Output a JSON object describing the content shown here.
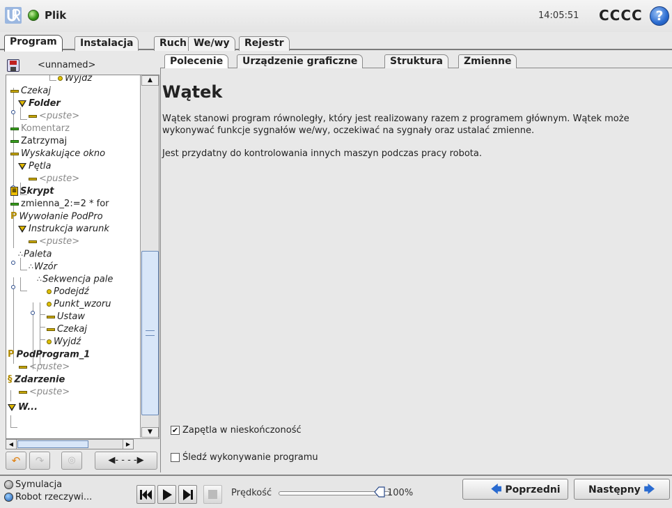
{
  "topbar": {
    "file_label": "Plik",
    "clock": "14:05:51",
    "robot_name": "CCCC",
    "help_label": "?"
  },
  "main_tabs": [
    "Program",
    "Instalacja",
    "Ruch",
    "We/wy",
    "Rejestr"
  ],
  "program": {
    "name": "<unnamed>"
  },
  "tree": [
    {
      "label": "Wyjdź",
      "icon": "waypoint-icon"
    },
    {
      "label": "Czekaj",
      "icon": "wait-icon"
    },
    {
      "label": "Folder",
      "icon": "folder-icon"
    },
    {
      "label": "<puste>",
      "icon": "wait-icon"
    },
    {
      "label": "Komentarz",
      "icon": "comment-icon"
    },
    {
      "label": "Zatrzymaj",
      "icon": "halt-icon"
    },
    {
      "label": "Wyskakujące okno",
      "icon": "popup-icon"
    },
    {
      "label": "Pętla",
      "icon": "loop-icon"
    },
    {
      "label": "<puste>",
      "icon": "wait-icon"
    },
    {
      "label": "Skrypt",
      "icon": "script-icon"
    },
    {
      "label": "zmienna_2:=2 * for",
      "icon": "assignment-icon"
    },
    {
      "label": "Wywołanie PodPro",
      "icon": "subprogram-call-icon"
    },
    {
      "label": "Instrukcja warunk",
      "icon": "if-icon"
    },
    {
      "label": "<puste>",
      "icon": "wait-icon"
    },
    {
      "label": "Paleta",
      "icon": "pallet-icon"
    },
    {
      "label": "Wzór",
      "icon": "pattern-icon"
    },
    {
      "label": "Sekwencja pale",
      "icon": "pallet-sequence-icon"
    },
    {
      "label": "Podejdź",
      "icon": "waypoint-icon"
    },
    {
      "label": "Punkt_wzoru",
      "icon": "waypoint-icon"
    },
    {
      "label": "Ustaw",
      "icon": "set-icon"
    },
    {
      "label": "Czekaj",
      "icon": "wait-icon"
    },
    {
      "label": "Wyjdź",
      "icon": "waypoint-icon"
    },
    {
      "label": "PodProgram_1",
      "icon": "subprogram-icon"
    },
    {
      "label": "<puste>",
      "icon": "wait-icon"
    },
    {
      "label": "Zdarzenie",
      "icon": "event-icon"
    },
    {
      "label": "<puste>",
      "icon": "wait-icon"
    },
    {
      "label": "W...",
      "icon": "thread-icon"
    }
  ],
  "sub_tabs": [
    "Polecenie",
    "Urządzenie graficzne",
    "Struktura",
    "Zmienne"
  ],
  "content": {
    "title": "Wątek",
    "description": "Wątek stanowi program równoległy, który jest realizowany razem z programem głównym. Wątek może wykonywać funkcje sygnałów we/wy, oczekiwać na sygnały oraz ustalać zmienne.",
    "note": "Jest przydatny do kontrolowania innych maszyn podczas pracy robota.",
    "loop_label": "Zapętla w nieskończoność",
    "loop_checked": true,
    "track_label": "Śledź wykonywanie programu",
    "track_checked": false
  },
  "bottom": {
    "sim_label": "Symulacja",
    "real_label": "Robot rzeczywi...",
    "speed_label": "Prędkość",
    "speed_value": "100%",
    "prev_label": "Poprzedni",
    "next_label": "Następny"
  }
}
